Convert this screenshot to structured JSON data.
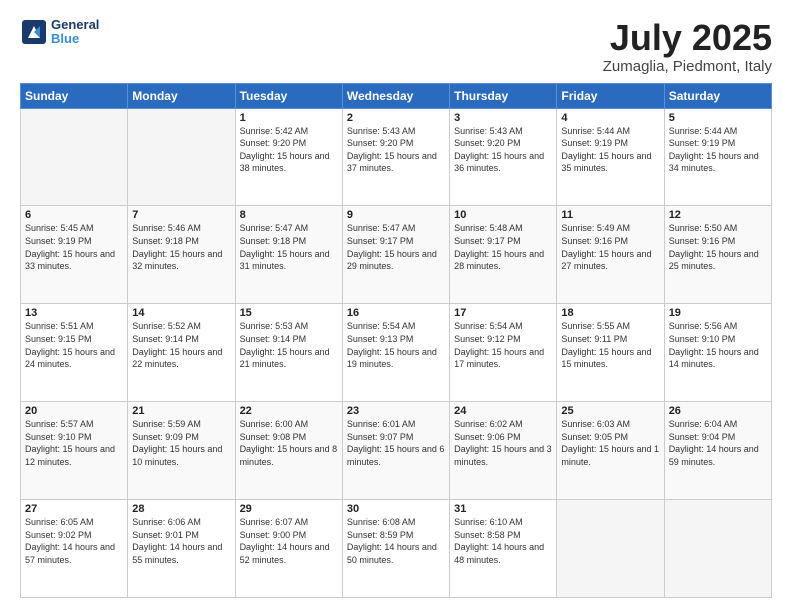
{
  "header": {
    "logo_line1": "General",
    "logo_line2": "Blue",
    "title": "July 2025",
    "subtitle": "Zumaglia, Piedmont, Italy"
  },
  "weekdays": [
    "Sunday",
    "Monday",
    "Tuesday",
    "Wednesday",
    "Thursday",
    "Friday",
    "Saturday"
  ],
  "rows": [
    [
      {
        "day": "",
        "empty": true
      },
      {
        "day": "",
        "empty": true
      },
      {
        "day": "1",
        "sunrise": "5:42 AM",
        "sunset": "9:20 PM",
        "daylight": "15 hours and 38 minutes."
      },
      {
        "day": "2",
        "sunrise": "5:43 AM",
        "sunset": "9:20 PM",
        "daylight": "15 hours and 37 minutes."
      },
      {
        "day": "3",
        "sunrise": "5:43 AM",
        "sunset": "9:20 PM",
        "daylight": "15 hours and 36 minutes."
      },
      {
        "day": "4",
        "sunrise": "5:44 AM",
        "sunset": "9:19 PM",
        "daylight": "15 hours and 35 minutes."
      },
      {
        "day": "5",
        "sunrise": "5:44 AM",
        "sunset": "9:19 PM",
        "daylight": "15 hours and 34 minutes."
      }
    ],
    [
      {
        "day": "6",
        "sunrise": "5:45 AM",
        "sunset": "9:19 PM",
        "daylight": "15 hours and 33 minutes."
      },
      {
        "day": "7",
        "sunrise": "5:46 AM",
        "sunset": "9:18 PM",
        "daylight": "15 hours and 32 minutes."
      },
      {
        "day": "8",
        "sunrise": "5:47 AM",
        "sunset": "9:18 PM",
        "daylight": "15 hours and 31 minutes."
      },
      {
        "day": "9",
        "sunrise": "5:47 AM",
        "sunset": "9:17 PM",
        "daylight": "15 hours and 29 minutes."
      },
      {
        "day": "10",
        "sunrise": "5:48 AM",
        "sunset": "9:17 PM",
        "daylight": "15 hours and 28 minutes."
      },
      {
        "day": "11",
        "sunrise": "5:49 AM",
        "sunset": "9:16 PM",
        "daylight": "15 hours and 27 minutes."
      },
      {
        "day": "12",
        "sunrise": "5:50 AM",
        "sunset": "9:16 PM",
        "daylight": "15 hours and 25 minutes."
      }
    ],
    [
      {
        "day": "13",
        "sunrise": "5:51 AM",
        "sunset": "9:15 PM",
        "daylight": "15 hours and 24 minutes."
      },
      {
        "day": "14",
        "sunrise": "5:52 AM",
        "sunset": "9:14 PM",
        "daylight": "15 hours and 22 minutes."
      },
      {
        "day": "15",
        "sunrise": "5:53 AM",
        "sunset": "9:14 PM",
        "daylight": "15 hours and 21 minutes."
      },
      {
        "day": "16",
        "sunrise": "5:54 AM",
        "sunset": "9:13 PM",
        "daylight": "15 hours and 19 minutes."
      },
      {
        "day": "17",
        "sunrise": "5:54 AM",
        "sunset": "9:12 PM",
        "daylight": "15 hours and 17 minutes."
      },
      {
        "day": "18",
        "sunrise": "5:55 AM",
        "sunset": "9:11 PM",
        "daylight": "15 hours and 15 minutes."
      },
      {
        "day": "19",
        "sunrise": "5:56 AM",
        "sunset": "9:10 PM",
        "daylight": "15 hours and 14 minutes."
      }
    ],
    [
      {
        "day": "20",
        "sunrise": "5:57 AM",
        "sunset": "9:10 PM",
        "daylight": "15 hours and 12 minutes."
      },
      {
        "day": "21",
        "sunrise": "5:59 AM",
        "sunset": "9:09 PM",
        "daylight": "15 hours and 10 minutes."
      },
      {
        "day": "22",
        "sunrise": "6:00 AM",
        "sunset": "9:08 PM",
        "daylight": "15 hours and 8 minutes."
      },
      {
        "day": "23",
        "sunrise": "6:01 AM",
        "sunset": "9:07 PM",
        "daylight": "15 hours and 6 minutes."
      },
      {
        "day": "24",
        "sunrise": "6:02 AM",
        "sunset": "9:06 PM",
        "daylight": "15 hours and 3 minutes."
      },
      {
        "day": "25",
        "sunrise": "6:03 AM",
        "sunset": "9:05 PM",
        "daylight": "15 hours and 1 minute."
      },
      {
        "day": "26",
        "sunrise": "6:04 AM",
        "sunset": "9:04 PM",
        "daylight": "14 hours and 59 minutes."
      }
    ],
    [
      {
        "day": "27",
        "sunrise": "6:05 AM",
        "sunset": "9:02 PM",
        "daylight": "14 hours and 57 minutes."
      },
      {
        "day": "28",
        "sunrise": "6:06 AM",
        "sunset": "9:01 PM",
        "daylight": "14 hours and 55 minutes."
      },
      {
        "day": "29",
        "sunrise": "6:07 AM",
        "sunset": "9:00 PM",
        "daylight": "14 hours and 52 minutes."
      },
      {
        "day": "30",
        "sunrise": "6:08 AM",
        "sunset": "8:59 PM",
        "daylight": "14 hours and 50 minutes."
      },
      {
        "day": "31",
        "sunrise": "6:10 AM",
        "sunset": "8:58 PM",
        "daylight": "14 hours and 48 minutes."
      },
      {
        "day": "",
        "empty": true
      },
      {
        "day": "",
        "empty": true
      }
    ]
  ]
}
